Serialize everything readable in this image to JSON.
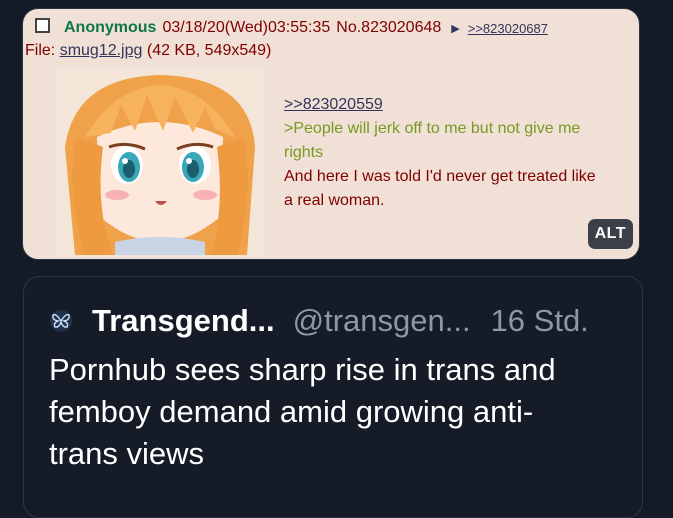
{
  "post": {
    "name": "Anonymous",
    "datetime": "03/18/20(Wed)03:55:35",
    "number": "No.823020648",
    "backlink": ">>823020687",
    "file_label": "File:",
    "file_name": "smug12.jpg",
    "file_info": "(42 KB, 549x549)",
    "quote_link": ">>823020559",
    "greentext": ">People will jerk off to me but not give me rights",
    "body_line": "And here I was told I'd never get treated like a real woman.",
    "alt_badge": "ALT"
  },
  "quoted": {
    "author": "Transgend...",
    "handle": "@transgen...",
    "time": "16 Std.",
    "text": "Pornhub sees sharp rise in trans and femboy demand amid growing anti-trans views"
  },
  "colors": {
    "page_bg": "#141b26",
    "post_bg": "#f0e0d6",
    "name_green": "#117743",
    "greentext": "#789922",
    "link_blue": "#34345c"
  }
}
